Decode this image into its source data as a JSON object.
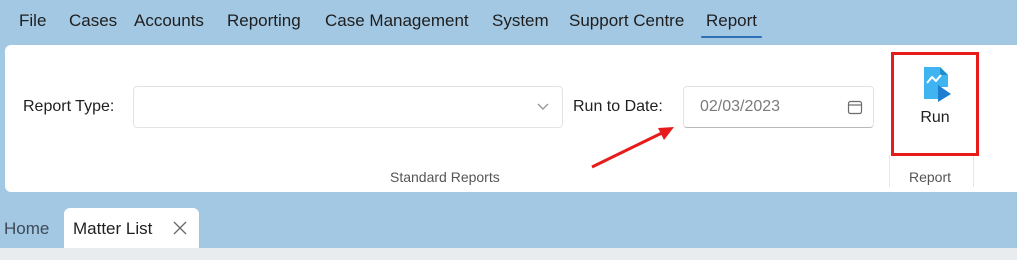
{
  "menu": {
    "items": [
      {
        "label": "File"
      },
      {
        "label": "Cases"
      },
      {
        "label": "Accounts"
      },
      {
        "label": "Reporting"
      },
      {
        "label": "Case Management"
      },
      {
        "label": "System"
      },
      {
        "label": "Support Centre"
      },
      {
        "label": "Report",
        "active": true
      }
    ]
  },
  "ribbon": {
    "report_type_label": "Report Type:",
    "report_type_value": "",
    "run_to_date_label": "Run to Date:",
    "run_to_date_value": "02/03/2023",
    "standard_group_label": "Standard Reports",
    "run_label": "Run",
    "report_group_label": "Report"
  },
  "tabs": {
    "home_label": "Home",
    "matter_label": "Matter List"
  },
  "colors": {
    "background": "#a3c8e3",
    "highlight": "#e81b1b",
    "icon_accent": "#2ba3e8"
  }
}
